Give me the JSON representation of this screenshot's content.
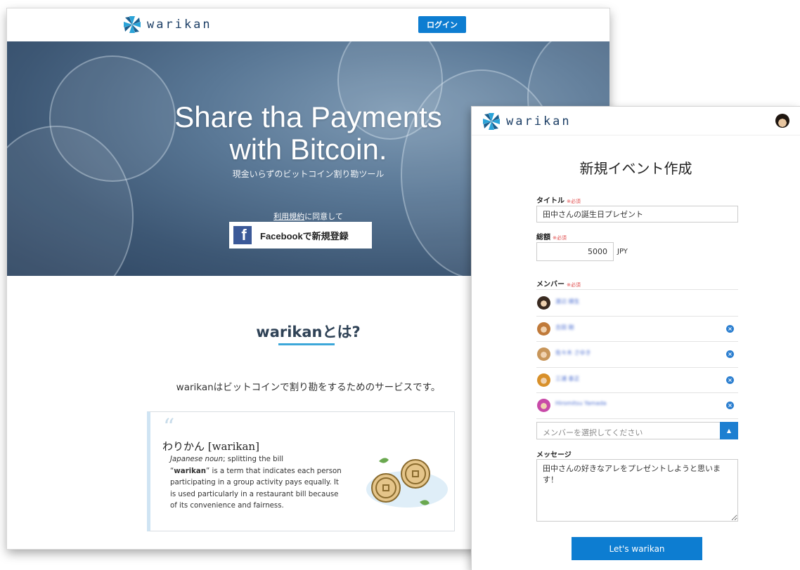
{
  "landing": {
    "logo_text": "warikan",
    "login_label": "ログイン",
    "hero_title_1": "Share tha Payments",
    "hero_title_2": "with Bitcoin.",
    "hero_subtitle": "現金いらずのビットコイン割り勘ツール",
    "terms_link": "利用規約",
    "terms_suffix": "に同意して",
    "facebook_icon": "facebook-f-icon",
    "facebook_label": "Facebookで新規登録",
    "about_title": "warikanとは?",
    "about_desc": "warikanはビットコインで割り勘をするためのサービスです。",
    "quote": {
      "mark": "“",
      "headword": "わりかん [warikan]",
      "pos": "Japanese noun",
      "pos_rest": "; splitting the bill",
      "term_open": "“",
      "term": "warikan",
      "definition": "” is a term that indicates each person participating in a group activity pays equally. It is used particularly in a restaurant bill because of its convenience and fairness."
    }
  },
  "app": {
    "logo_text": "warikan",
    "page_title": "新規イベント作成",
    "title_label": "タイトル",
    "required_mark": "※必須",
    "title_value": "田中さんの誕生日プレゼント",
    "amount_label": "総額",
    "amount_value": "5000",
    "currency": "JPY",
    "members_label": "メンバー",
    "members": [
      {
        "name": "渡辺 順生",
        "removable": false,
        "avatar_color": "#3a2a20"
      },
      {
        "name": "吉田 剛",
        "removable": true,
        "avatar_color": "#c07a3a"
      },
      {
        "name": "佐々木 さゆき",
        "removable": true,
        "avatar_color": "#c8965a"
      },
      {
        "name": "三浦 泰正",
        "removable": true,
        "avatar_color": "#d8902a"
      },
      {
        "name": "Hiromitsu Yamada",
        "removable": true,
        "avatar_color": "#c84aa8"
      }
    ],
    "member_select_placeholder": "メンバーを選択してください",
    "message_label": "メッセージ",
    "message_value": "田中さんの好きなアレをプレゼントしようと思います！",
    "submit_label": "Let's warikan"
  }
}
